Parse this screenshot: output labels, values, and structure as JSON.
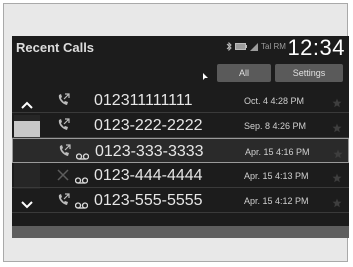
{
  "header": {
    "title": "Recent Calls",
    "status_text": "Tal RM",
    "clock": "12:34"
  },
  "tabs": [
    {
      "label": "All"
    },
    {
      "label": "Settings"
    }
  ],
  "calls": [
    {
      "number": "012311111111",
      "date": "Oct. 4 4:28 PM",
      "call_type": "phone-incoming",
      "voicemail": false,
      "missed": false
    },
    {
      "number": "0123-222-2222",
      "date": "Sep. 8 4:26 PM",
      "call_type": "phone-incoming",
      "voicemail": false,
      "missed": false
    },
    {
      "number": "0123-333-3333",
      "date": "Apr. 15 4:16 PM",
      "call_type": "phone-incoming",
      "voicemail": true,
      "missed": false
    },
    {
      "number": "0123-444-4444",
      "date": "Apr. 15 4:13 PM",
      "call_type": "phone-missed",
      "voicemail": true,
      "missed": true
    },
    {
      "number": "0123-555-5555",
      "date": "Apr. 15 4:12 PM",
      "call_type": "phone-incoming",
      "voicemail": true,
      "missed": false
    }
  ],
  "selected_index": 2,
  "colors": {
    "screen_bg": "#1c1c1c",
    "tab_bg": "#5a5a5a",
    "text": "#e6e6e6"
  }
}
